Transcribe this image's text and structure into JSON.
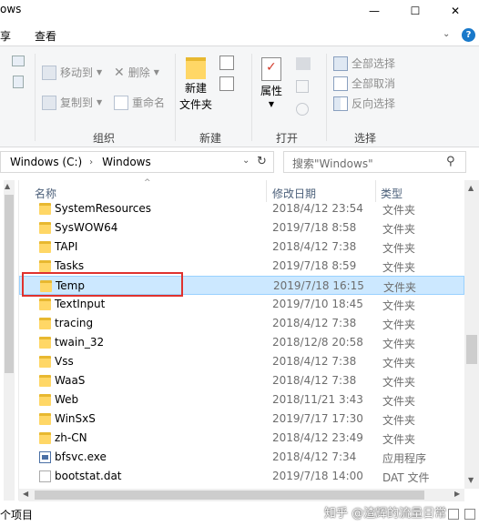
{
  "window": {
    "title_fragment": "ows",
    "minimize_glyph": "—",
    "maximize_glyph": "☐",
    "close_glyph": "✕"
  },
  "tabs": {
    "share": "享",
    "view": "查看",
    "collapse_glyph": "⌄",
    "help_glyph": "?"
  },
  "ribbon": {
    "move_to": "移动到",
    "copy_to": "复制到",
    "delete": "删除",
    "rename": "重命名",
    "organize": "组织",
    "new_folder_line1": "新建",
    "new_folder_line2": "文件夹",
    "new_group": "新建",
    "properties": "属性",
    "open_group": "打开",
    "select_all": "全部选择",
    "select_none": "全部取消",
    "invert_selection": "反向选择",
    "select_group": "选择"
  },
  "address": {
    "segments": [
      "Windows (C:)",
      "Windows"
    ],
    "chevron": "›",
    "dropdown_glyph": "⌄",
    "refresh_glyph": "↻"
  },
  "search": {
    "placeholder": "搜索\"Windows\"",
    "icon_glyph": "⚲"
  },
  "columns": {
    "name": "名称",
    "date": "修改日期",
    "type": "类型",
    "sort_glyph": "^"
  },
  "files": [
    {
      "name": "SystemResources",
      "date": "2018/4/12 23:54",
      "type": "文件夹",
      "kind": "folder"
    },
    {
      "name": "SysWOW64",
      "date": "2019/7/18 8:58",
      "type": "文件夹",
      "kind": "folder"
    },
    {
      "name": "TAPI",
      "date": "2018/4/12 7:38",
      "type": "文件夹",
      "kind": "folder"
    },
    {
      "name": "Tasks",
      "date": "2019/7/18 8:59",
      "type": "文件夹",
      "kind": "folder"
    },
    {
      "name": "Temp",
      "date": "2019/7/18 16:15",
      "type": "文件夹",
      "kind": "folder",
      "selected": true
    },
    {
      "name": "TextInput",
      "date": "2019/7/10 18:45",
      "type": "文件夹",
      "kind": "folder"
    },
    {
      "name": "tracing",
      "date": "2018/4/12 7:38",
      "type": "文件夹",
      "kind": "folder"
    },
    {
      "name": "twain_32",
      "date": "2018/12/8 20:58",
      "type": "文件夹",
      "kind": "folder"
    },
    {
      "name": "Vss",
      "date": "2018/4/12 7:38",
      "type": "文件夹",
      "kind": "folder"
    },
    {
      "name": "WaaS",
      "date": "2018/4/12 7:38",
      "type": "文件夹",
      "kind": "folder"
    },
    {
      "name": "Web",
      "date": "2018/11/21 3:43",
      "type": "文件夹",
      "kind": "folder"
    },
    {
      "name": "WinSxS",
      "date": "2019/7/17 17:30",
      "type": "文件夹",
      "kind": "folder"
    },
    {
      "name": "zh-CN",
      "date": "2018/4/12 23:49",
      "type": "文件夹",
      "kind": "folder"
    },
    {
      "name": "bfsvc.exe",
      "date": "2018/4/12 7:34",
      "type": "应用程序",
      "kind": "exe"
    },
    {
      "name": "bootstat.dat",
      "date": "2019/7/18 14:00",
      "type": "DAT 文件",
      "kind": "dat"
    }
  ],
  "statusbar": {
    "count": "个项目",
    "watermark": "知乎 @渣辉的流量日常"
  },
  "scroll_glyphs": {
    "up": "▲",
    "down": "▼",
    "left": "◀",
    "right": "▶"
  }
}
